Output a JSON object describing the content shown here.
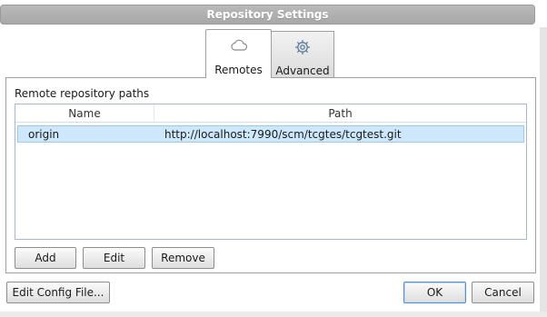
{
  "window": {
    "title": "Repository Settings"
  },
  "tabs": [
    {
      "label": "Remotes",
      "icon": "cloud-icon",
      "selected": true
    },
    {
      "label": "Advanced",
      "icon": "gear-icon",
      "selected": false
    }
  ],
  "remotes": {
    "section_title": "Remote repository paths",
    "columns": [
      "Name",
      "Path"
    ],
    "rows": [
      {
        "name": "origin",
        "path": "http://localhost:7990/scm/tcgtes/tcgtest.git",
        "selected": true
      }
    ],
    "buttons": {
      "add": "Add",
      "edit": "Edit",
      "remove": "Remove"
    }
  },
  "footer": {
    "edit_config": "Edit Config File...",
    "ok": "OK",
    "cancel": "Cancel"
  },
  "colors": {
    "selection": "#cde8fb",
    "selection_border": "#9fc9ea",
    "titlebar": "#aeaeae",
    "default_button_border": "#5a8ec2"
  }
}
